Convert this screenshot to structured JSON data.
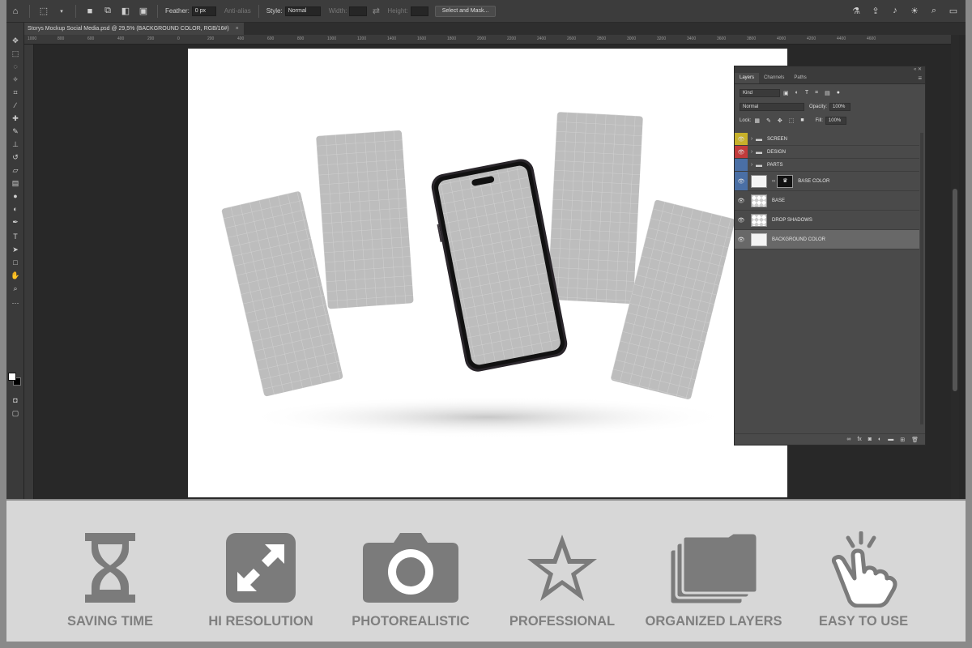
{
  "options_bar": {
    "feather_label": "Feather:",
    "feather_value": "0 px",
    "antialias_label": "Anti-alias",
    "style_label": "Style:",
    "style_value": "Normal",
    "width_label": "Width:",
    "height_label": "Height:",
    "select_mask_label": "Select and Mask..."
  },
  "document": {
    "tab_title": "Storys Mockup Social Media.psd @ 29,5% (BACKGROUND COLOR, RGB/16#)",
    "close_glyph": "×"
  },
  "ruler": {
    "ticks": [
      "1000",
      "800",
      "600",
      "400",
      "200",
      "0",
      "200",
      "400",
      "600",
      "800",
      "1000",
      "1200",
      "1400",
      "1600",
      "1800",
      "2000",
      "2200",
      "2400",
      "2600",
      "2800",
      "3000",
      "3200",
      "3400",
      "3600",
      "3800",
      "4000",
      "4200",
      "4400",
      "4600"
    ]
  },
  "layers_panel": {
    "tabs": [
      "Layers",
      "Channels",
      "Paths"
    ],
    "filter_value": "Kind",
    "blend_mode": "Normal",
    "opacity_label": "Opacity:",
    "opacity_value": "100%",
    "lock_label": "Lock:",
    "fill_label": "Fill:",
    "fill_value": "100%",
    "layers": [
      {
        "name": "SCREEN",
        "type": "group",
        "color": "#c7b12a"
      },
      {
        "name": "DESIGN",
        "type": "group",
        "color": "#c23b3b"
      },
      {
        "name": "PARTS",
        "type": "group",
        "color": "#4a6fa5"
      },
      {
        "name": "BASE COLOR",
        "type": "masked",
        "color": "#4a6fa5"
      },
      {
        "name": "BASE",
        "type": "pixel",
        "color": ""
      },
      {
        "name": "DROP SHADOWS",
        "type": "pixel",
        "color": ""
      },
      {
        "name": "BACKGROUND COLOR",
        "type": "fill",
        "color": ""
      }
    ]
  },
  "features": [
    {
      "label": "SAVING TIME",
      "icon": "hourglass-icon"
    },
    {
      "label": "HI RESOLUTION",
      "icon": "expand-icon"
    },
    {
      "label": "PHOTOREALISTIC",
      "icon": "camera-icon"
    },
    {
      "label": "PROFESSIONAL",
      "icon": "star-icon"
    },
    {
      "label": "ORGANIZED LAYERS",
      "icon": "layers-icon"
    },
    {
      "label": "EASY TO USE",
      "icon": "tap-hand-icon"
    }
  ],
  "colors": {
    "feature_gray": "#7b7b7b",
    "feature_band": "#d7d7d7",
    "selected_layer": "#686868"
  }
}
